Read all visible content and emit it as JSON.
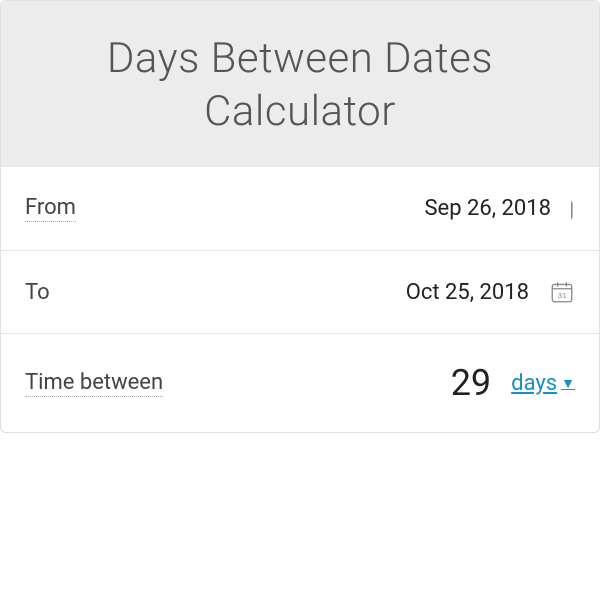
{
  "header": {
    "title": "Days Between Dates Calculator"
  },
  "rows": {
    "from": {
      "label": "From",
      "value": "Sep 26, 2018"
    },
    "to": {
      "label": "To",
      "value": "Oct 25, 2018",
      "icon_day": "31"
    },
    "result": {
      "label": "Time between",
      "value": "29",
      "unit": "days"
    }
  }
}
